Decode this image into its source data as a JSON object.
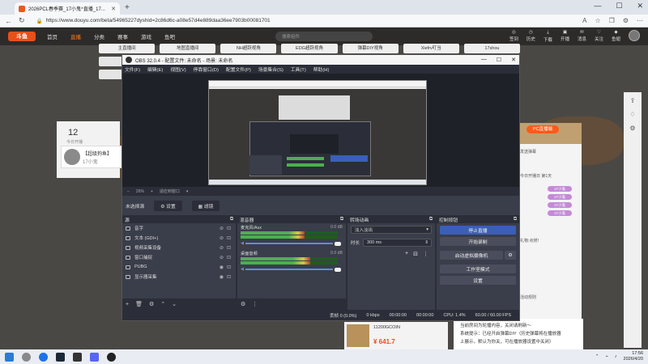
{
  "browser": {
    "tab_title": "2026PCL春季赛_17小鬼^直播_17...",
    "url": "https://www.douyu.com/beta/54965227dyshid=2c86d6c-a08e57d4e889daa36ee7903b00081701"
  },
  "douyu": {
    "logo": "斗鱼",
    "nav": [
      "首页",
      "直播",
      "分类",
      "赛事",
      "游戏",
      "鱼吧"
    ],
    "search_placeholder": "搜索组件",
    "icons": [
      "签到",
      "历史",
      "下载",
      "开播",
      "消息",
      "关注",
      "鱼翅"
    ],
    "categories": [
      "主直播间",
      "地图直播间",
      "NH超跃视角",
      "EDG超跃视角",
      "弹幕DIY视角",
      "Xiefrv叮当",
      "17shou"
    ],
    "room_count": "12",
    "room_label": "今日开播",
    "host_name": "【超级狗鱼】",
    "host_sub": "17小鬼",
    "right_panel_btn": "PC直播端",
    "chat_lines": [
      "发送弹幕",
      "今日开播日 第1天",
      "礼物:点燃！",
      "活动规则"
    ],
    "chat_badges": [
      "17小鬼",
      "17小鬼",
      "17小鬼",
      "17小鬼"
    ],
    "bottom_chat": [
      "当前房间为轮播内容，关闭请刷新～",
      "系统提示：已经开启弹幕DIY（历史弹幕将在播放器",
      "上展示，默认为你关，可在播放器设置中关闭）"
    ],
    "ad_title": "11200GCOIN",
    "ad_price": "¥ 641.7"
  },
  "obs": {
    "title": "OBS 32.0.4 - 配置文件: 未命名 - 场景: 未命名",
    "menu": [
      "文件(F)",
      "编辑(E)",
      "视图(V)",
      "停靠窗口(D)",
      "配置文件(P)",
      "场景集合(S)",
      "工具(T)",
      "帮助(H)"
    ],
    "zoom": "26%",
    "zoom_label": "适应到窗口",
    "no_source": "未选择源",
    "btn_settings": "设置",
    "btn_filters": "滤镜",
    "sources_title": "源",
    "sources": [
      {
        "name": "音字"
      },
      {
        "name": "文本 (GDI+)"
      },
      {
        "name": "视频采集设备"
      },
      {
        "name": "窗口捕捉"
      },
      {
        "name": "PUBG"
      },
      {
        "name": "显示器采集"
      }
    ],
    "mixer_title": "混音器",
    "mixer": [
      {
        "name": "麦克风/Aux",
        "db": "0.0 dB",
        "level": 0.66
      },
      {
        "name": "桌面音频",
        "db": "0.0 dB",
        "level": 0.72
      }
    ],
    "transition_title": "转场动画",
    "transition_type": "淡入淡出",
    "duration_label": "时长",
    "duration_value": "300 ms",
    "controls_title": "控制按钮",
    "controls": [
      "停止直播",
      "开始录制",
      "启动虚拟摄像机",
      "工作室模式",
      "设置"
    ],
    "status": {
      "dropped": "丢帧 0 (0.0%)",
      "kbps": "0 kbps",
      "stream_time": "00:00:00",
      "rec_time": "00:00:00",
      "cpu": "CPU: 1.4%",
      "fps": "60.00 / 60.00 FPS"
    }
  },
  "taskbar": {
    "time": "17:56",
    "date": "2026/4/20"
  }
}
